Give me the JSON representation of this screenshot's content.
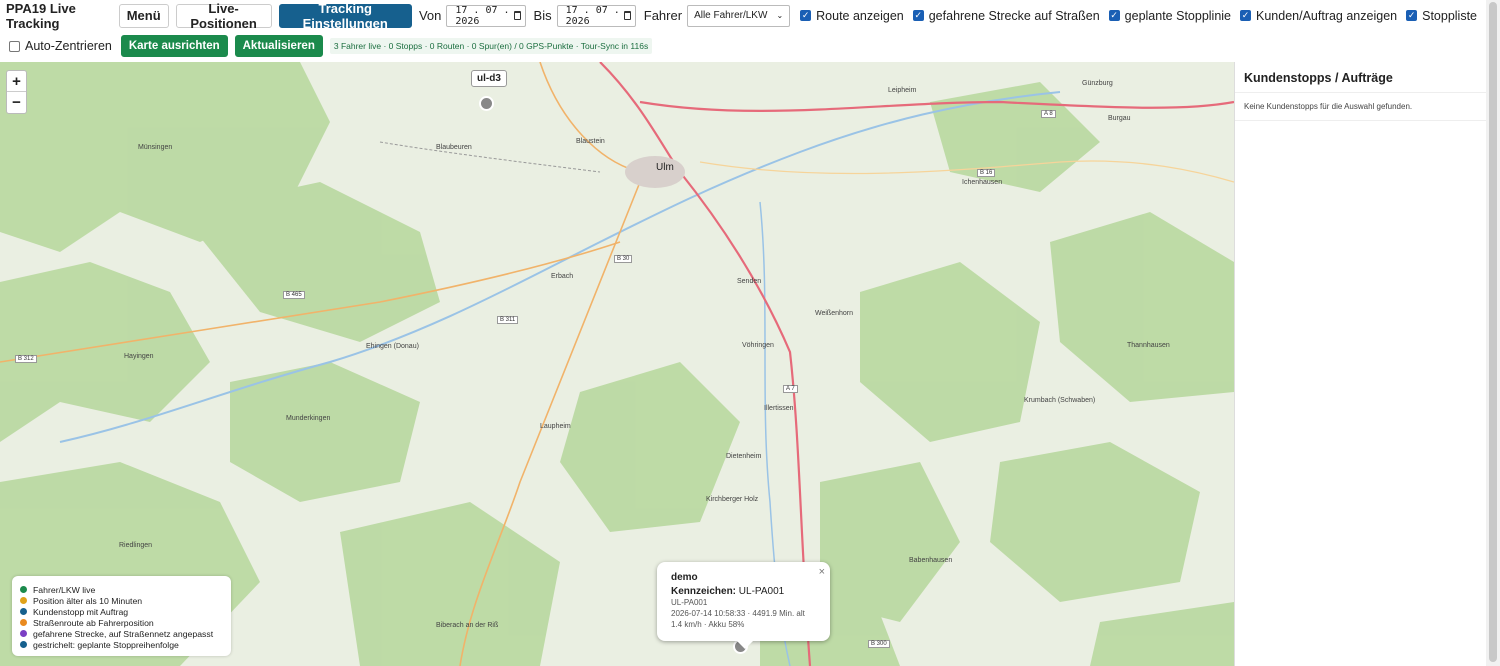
{
  "app_title": "PPA19 Live Tracking",
  "toolbar": {
    "menu_label": "Menü",
    "live_positions_label": "Live-Positionen",
    "tracking_settings_label": "Tracking Einstellungen",
    "from_label": "Von",
    "from_date": "17 . 07 . 2026",
    "to_label": "Bis",
    "to_date": "17 . 07 . 2026",
    "driver_label": "Fahrer",
    "driver_select": "Alle Fahrer/LKW",
    "checkboxes": [
      {
        "label": "Route anzeigen",
        "checked": true
      },
      {
        "label": "gefahrene Strecke auf Straßen",
        "checked": true
      },
      {
        "label": "geplante Stopplinie",
        "checked": true
      },
      {
        "label": "Kunden/Auftrag anzeigen",
        "checked": true
      },
      {
        "label": "Stoppliste",
        "checked": true
      }
    ]
  },
  "toolbar2": {
    "auto_center_label": "Auto-Zentrieren",
    "auto_center_checked": false,
    "fit_map_label": "Karte ausrichten",
    "refresh_label": "Aktualisieren",
    "status_text": "3 Fahrer live · 0 Stopps · 0 Routen · 0 Spur(en) / 0 GPS-Punkte · Tour-Sync in 116s"
  },
  "map": {
    "zoom_in": "+",
    "zoom_out": "−",
    "marker_label": "ul-d3",
    "places": [
      {
        "name": "Ulm",
        "big": true
      },
      {
        "name": "Günzburg"
      },
      {
        "name": "Leipheim"
      },
      {
        "name": "Burgau"
      },
      {
        "name": "Blaustein"
      },
      {
        "name": "Blaubeuren"
      },
      {
        "name": "Münsingen"
      },
      {
        "name": "Ichenhausen"
      },
      {
        "name": "Erbach"
      },
      {
        "name": "Senden"
      },
      {
        "name": "Weißenhorn"
      },
      {
        "name": "Vöhringen"
      },
      {
        "name": "Ehingen (Donau)"
      },
      {
        "name": "Hayingen"
      },
      {
        "name": "Munderkingen"
      },
      {
        "name": "Laupheim"
      },
      {
        "name": "Illertissen"
      },
      {
        "name": "Dietenheim"
      },
      {
        "name": "Thannhausen"
      },
      {
        "name": "Krumbach (Schwaben)"
      },
      {
        "name": "Riedlingen"
      },
      {
        "name": "Babenhausen"
      },
      {
        "name": "Biberach an der Riß"
      },
      {
        "name": "Kirchberger Holz"
      }
    ],
    "roads": [
      "B 465",
      "B 311",
      "B 312",
      "B 30",
      "A 7",
      "A 8",
      "B 16",
      "B 300"
    ]
  },
  "legend": [
    {
      "label": "Fahrer/LKW live",
      "color": "#1b8a4c"
    },
    {
      "label": "Position älter als 10 Minuten",
      "color": "#e0a21a"
    },
    {
      "label": "Kundenstopp mit Auftrag",
      "color": "#16608e"
    },
    {
      "label": "Straßenroute ab Fahrerposition",
      "color": "#e98a1f"
    },
    {
      "label": "gefahrene Strecke, auf Straßennetz angepasst",
      "color": "#7b3fc4"
    },
    {
      "label": "gestrichelt: geplante Stoppreihenfolge",
      "color": "#16608e"
    }
  ],
  "popup": {
    "title": "demo",
    "plate_label": "Kennzeichen:",
    "plate_value": "UL-PA001",
    "line1": "UL-PA001",
    "line2": "2026-07-14 10:58:33 · 4491.9 Min. alt",
    "line3": "1.4 km/h · Akku 58%",
    "close": "×"
  },
  "panel": {
    "title": "Kundenstopps / Aufträge",
    "empty_text": "Keine Kundenstopps für die Auswahl gefunden."
  }
}
